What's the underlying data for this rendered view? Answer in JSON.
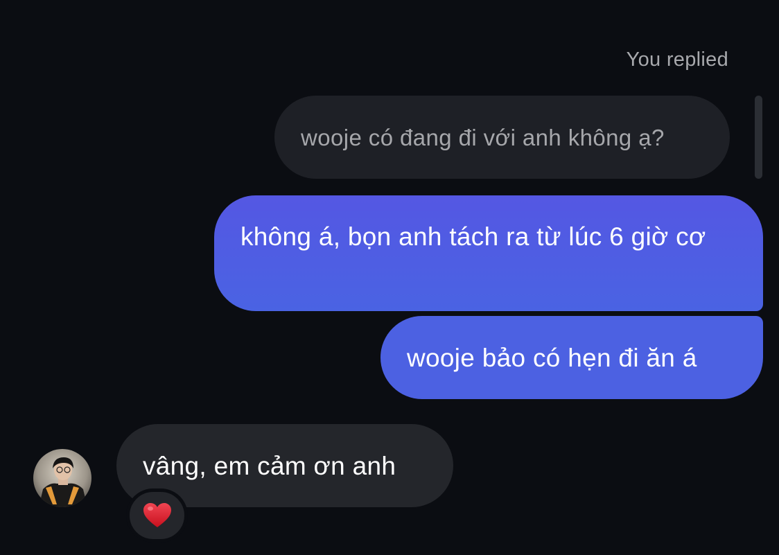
{
  "thread": {
    "replied_label": "You replied",
    "quoted_message": "wooje có đang đi với anh không ạ?",
    "sent_messages": [
      {
        "text": "không á, bọn anh tách ra từ lúc 6 giờ cơ"
      },
      {
        "text": "wooje bảo có hẹn đi ăn á"
      }
    ],
    "received_message": {
      "text": "vâng, em cảm ơn anh",
      "reaction": "heart-icon"
    }
  },
  "colors": {
    "background": "#0b0d12",
    "sent_bubble": "#4c61e2",
    "received_bubble": "#24262b",
    "quoted_text": "#a6a7ab",
    "reaction_heart": "#e5222f"
  }
}
